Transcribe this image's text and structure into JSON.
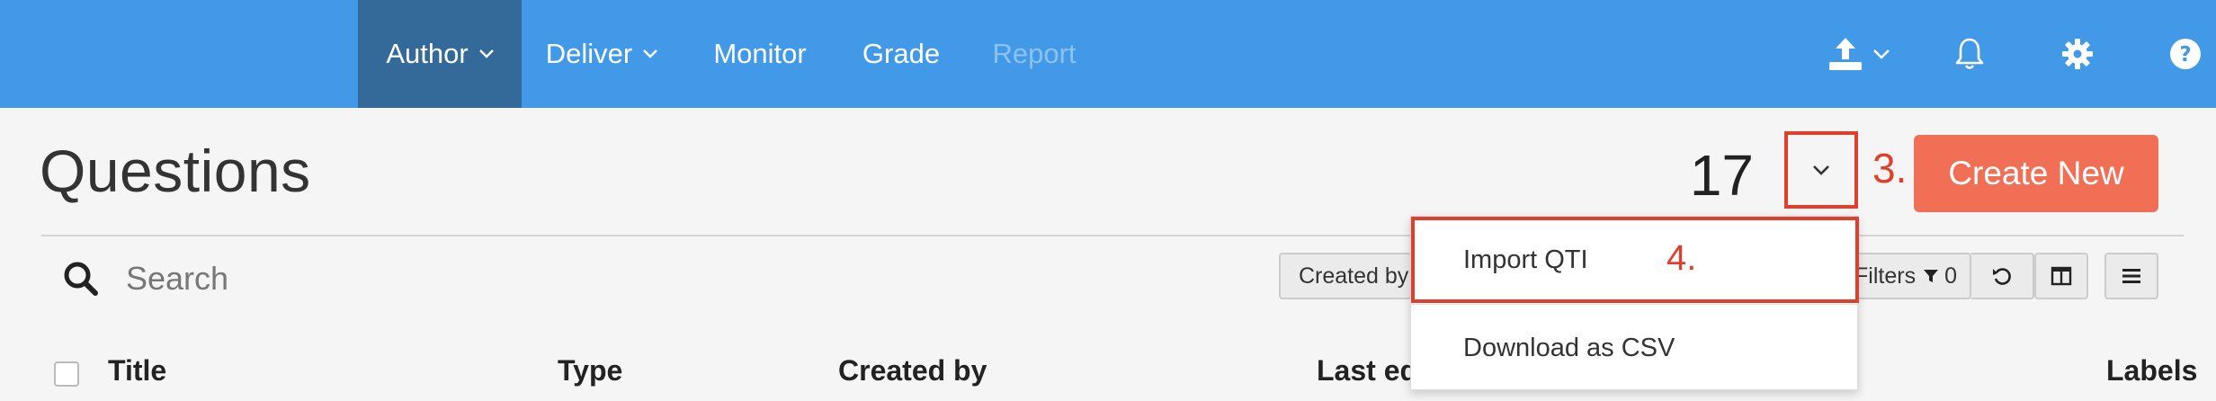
{
  "nav": {
    "items": [
      {
        "label": "Author",
        "has_caret": true,
        "state": "active"
      },
      {
        "label": "Deliver",
        "has_caret": true,
        "state": "normal"
      },
      {
        "label": "Monitor",
        "has_caret": false,
        "state": "normal"
      },
      {
        "label": "Grade",
        "has_caret": false,
        "state": "normal"
      },
      {
        "label": "Report",
        "has_caret": false,
        "state": "disabled"
      }
    ],
    "icons": [
      "upload-icon",
      "bell-icon",
      "gear-icon",
      "help-icon"
    ]
  },
  "header": {
    "title": "Questions",
    "count": "17",
    "create_label": "Create New",
    "annotation_dropdown": "3."
  },
  "search": {
    "placeholder": "Search"
  },
  "toolbar": {
    "created_by_label": "Created by",
    "filters_label": "Filters",
    "filters_count": "0"
  },
  "table": {
    "columns": [
      "Title",
      "Type",
      "Created by",
      "Last ed",
      "Labels"
    ]
  },
  "dropdown_menu": {
    "items": [
      "Import QTI",
      "Download as CSV"
    ],
    "annotation_item": "4."
  },
  "colors": {
    "nav_bg": "#4299e8",
    "nav_active": "#336a99",
    "accent": "#f06f55",
    "annotation": "#e0402b",
    "page_bg": "#f5f5f5"
  }
}
